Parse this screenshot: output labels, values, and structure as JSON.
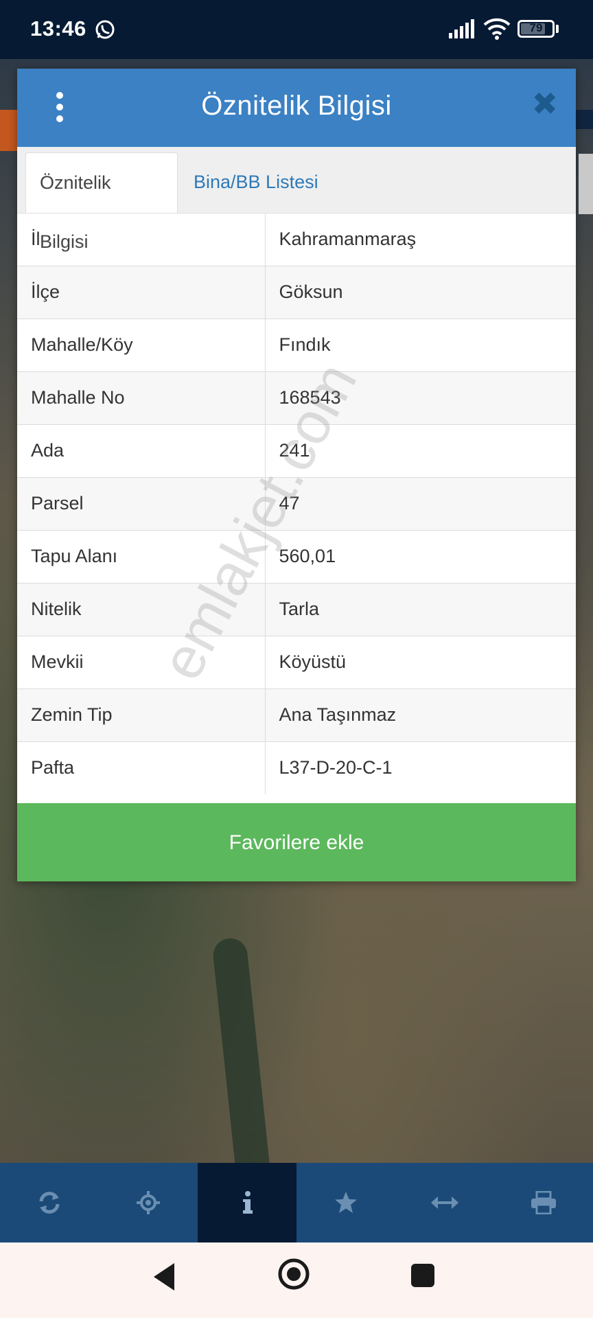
{
  "status_bar": {
    "time": "13:46",
    "battery": "79",
    "battery_level": 0.79,
    "icons": [
      "whatsapp-icon",
      "signal-icon",
      "wifi-icon",
      "battery-icon"
    ]
  },
  "modal": {
    "title": "Öznitelik Bilgisi",
    "menu_icon": "kebab-menu-icon",
    "close_icon": "close-icon",
    "tabs": [
      {
        "label": "Öznitelik Bilgisi",
        "active": true
      },
      {
        "label": "Bina/BB Listesi",
        "active": false
      }
    ],
    "rows": [
      {
        "key": "İl",
        "value": "Kahramanmaraş"
      },
      {
        "key": "İlçe",
        "value": "Göksun"
      },
      {
        "key": "Mahalle/Köy",
        "value": "Fındık"
      },
      {
        "key": "Mahalle No",
        "value": "168543"
      },
      {
        "key": "Ada",
        "value": "241"
      },
      {
        "key": "Parsel",
        "value": "47"
      },
      {
        "key": "Tapu Alanı",
        "value": "560,01"
      },
      {
        "key": "Nitelik",
        "value": "Tarla"
      },
      {
        "key": "Mevkii",
        "value": "Köyüstü"
      },
      {
        "key": "Zemin Tip",
        "value": "Ana Taşınmaz"
      },
      {
        "key": "Pafta",
        "value": "L37-D-20-C-1"
      }
    ],
    "favorite_button": "Favorilere ekle",
    "watermark": "emlakjet.com"
  },
  "toolbar": {
    "items": [
      {
        "icon": "refresh-icon"
      },
      {
        "icon": "locate-icon"
      },
      {
        "icon": "info-icon",
        "active": true
      },
      {
        "icon": "star-icon"
      },
      {
        "icon": "measure-icon"
      },
      {
        "icon": "print-icon"
      }
    ]
  },
  "nav_bar": {
    "icons": [
      "back-icon",
      "home-icon",
      "recents-icon"
    ]
  },
  "colors": {
    "header": "#3b81c4",
    "button": "#5cb85c",
    "toolbar": "#1b4a78",
    "status_bar": "#061a33"
  }
}
